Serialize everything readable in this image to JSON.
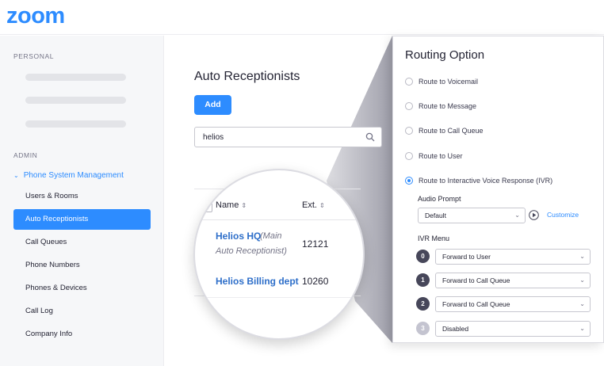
{
  "header": {
    "logo": "zoom"
  },
  "sidebar": {
    "personal_label": "PERSONAL",
    "admin_label": "ADMIN",
    "group_label": "Phone System Management",
    "items": [
      {
        "label": "Users & Rooms",
        "active": false
      },
      {
        "label": "Auto Receptionists",
        "active": true
      },
      {
        "label": "Call Queues",
        "active": false
      },
      {
        "label": "Phone Numbers",
        "active": false
      },
      {
        "label": "Phones & Devices",
        "active": false
      },
      {
        "label": "Call Log",
        "active": false
      },
      {
        "label": "Company Info",
        "active": false
      }
    ]
  },
  "main": {
    "title": "Auto Receptionists",
    "add_label": "Add",
    "search_value": "helios",
    "table": {
      "columns": [
        "Name",
        "Ext."
      ],
      "rows": [
        {
          "name": "Helios HQ",
          "note": "(Main Auto Receptionist)",
          "note_line1": "(Main",
          "note_line2": "Auto Receptionist)",
          "ext": "12121"
        },
        {
          "name": "Helios Billing dept",
          "note": "",
          "ext": "10260"
        }
      ]
    }
  },
  "routing": {
    "title": "Routing Option",
    "options": [
      {
        "label": "Route to Voicemail",
        "selected": false
      },
      {
        "label": "Route to Message",
        "selected": false
      },
      {
        "label": "Route to Call Queue",
        "selected": false
      },
      {
        "label": "Route to User",
        "selected": false
      },
      {
        "label": "Route to Interactive Voice Response (IVR)",
        "selected": true
      }
    ],
    "audio_prompt_label": "Audio Prompt",
    "audio_prompt_value": "Default",
    "customize_label": "Customize",
    "ivr_menu_label": "IVR Menu",
    "ivr_menu": [
      {
        "key": "0",
        "action": "Forward to User"
      },
      {
        "key": "1",
        "action": "Forward to Call Queue"
      },
      {
        "key": "2",
        "action": "Forward to Call Queue"
      },
      {
        "key": "3",
        "action": "Disabled"
      }
    ]
  },
  "colors": {
    "accent": "#2d8cff",
    "sidebar_bg": "#f6f7f9",
    "text": "#232333"
  }
}
